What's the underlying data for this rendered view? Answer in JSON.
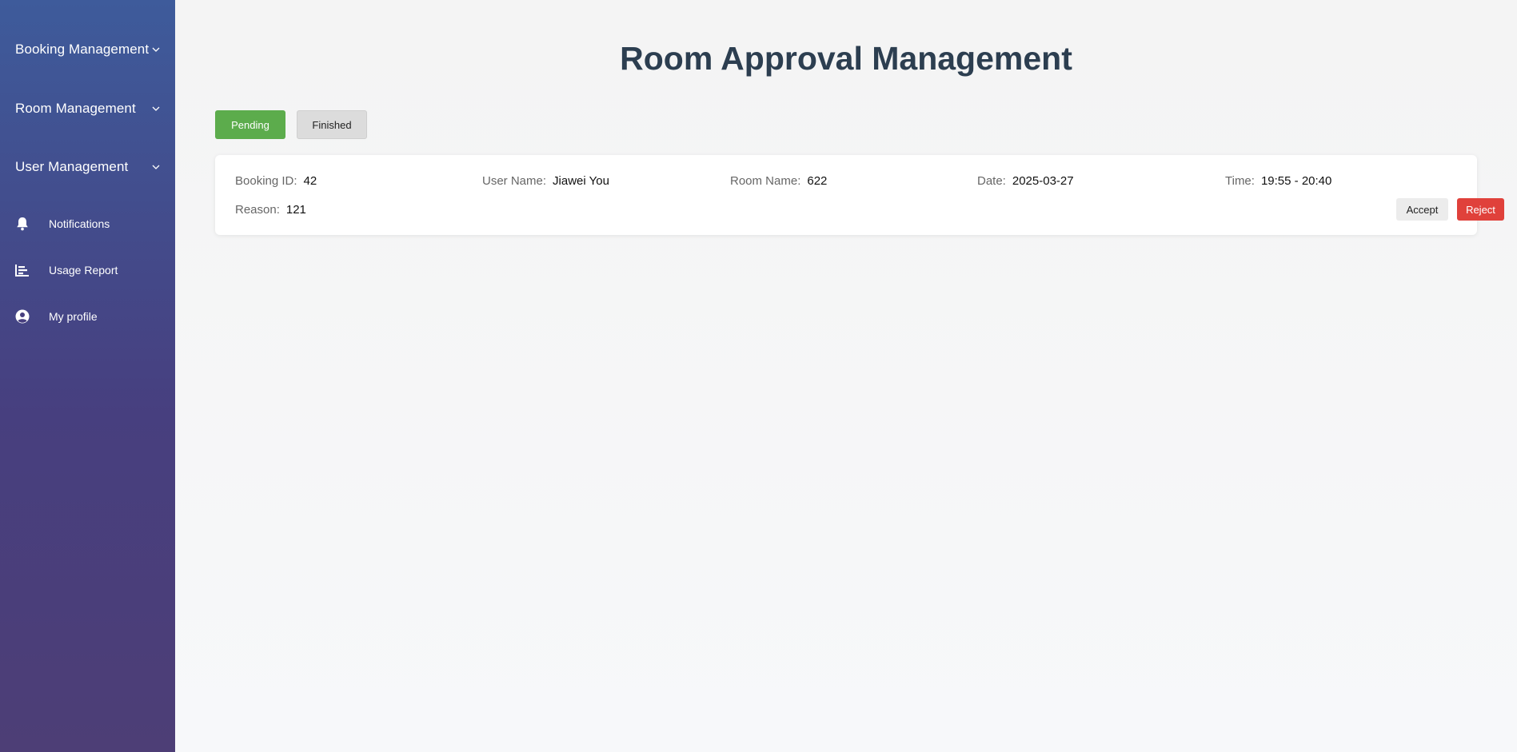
{
  "sidebar": {
    "groups": [
      {
        "label": "Booking Management"
      },
      {
        "label": "Room Management"
      },
      {
        "label": "User Management"
      }
    ],
    "items": [
      {
        "label": "Notifications",
        "icon": "bell-icon"
      },
      {
        "label": "Usage Report",
        "icon": "bar-chart-icon"
      },
      {
        "label": "My profile",
        "icon": "user-circle-icon"
      }
    ]
  },
  "main": {
    "title": "Room Approval Management",
    "tabs": [
      {
        "label": "Pending",
        "active": true,
        "color": "#5cac4c"
      },
      {
        "label": "Finished",
        "active": false
      }
    ],
    "booking": {
      "id_label": "Booking ID:",
      "id": "42",
      "user_label": "User Name:",
      "user": "Jiawei You",
      "room_label": "Room Name:",
      "room": "622",
      "date_label": "Date:",
      "date": "2025-03-27",
      "time_label": "Time:",
      "time": "19:55 - 20:40",
      "reason_label": "Reason:",
      "reason": "121",
      "accept_label": "Accept",
      "reject_label": "Reject"
    }
  },
  "colors": {
    "accent_green": "#5cac4c",
    "reject_red": "#e0413b",
    "title": "#2c3e50"
  }
}
